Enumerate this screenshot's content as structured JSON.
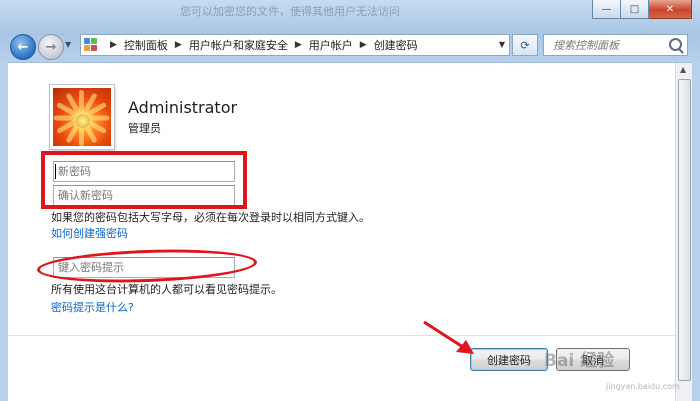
{
  "window": {
    "title": "您可以加密您的文件，使得其他用户无法访问",
    "buttons": {
      "minimize": "—",
      "maximize": "□",
      "close": "✕"
    }
  },
  "address_bar": {
    "breadcrumbs": [
      "控制面板",
      "用户帐户和家庭安全",
      "用户帐户",
      "创建密码"
    ]
  },
  "search": {
    "placeholder": "搜索控制面板"
  },
  "user": {
    "name": "Administrator",
    "role": "管理员"
  },
  "form": {
    "new_password_placeholder": "新密码",
    "confirm_password_placeholder": "确认新密码",
    "case_hint": "如果您的密码包括大写字母，必须在每次登录时以相同方式键入。",
    "strong_password_link": "如何创建强密码",
    "hint_placeholder": "键入密码提示",
    "hint_visibility_note": "所有使用这台计算机的人都可以看见密码提示。",
    "what_is_hint_link": "密码提示是什么?"
  },
  "actions": {
    "create_label": "创建密码",
    "cancel_label": "取消"
  },
  "annotations": {
    "color": "#e0141c"
  },
  "watermark": {
    "text": "Bai 经验",
    "subtext": "jingyan.baidu.com"
  },
  "colors": {
    "link": "#0a66c8",
    "frame": "#b9d1ea"
  }
}
